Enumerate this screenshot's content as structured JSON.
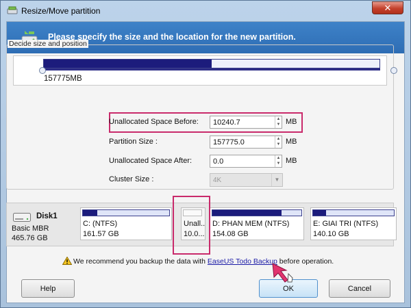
{
  "window": {
    "title": "Resize/Move partition",
    "close_label": "✕"
  },
  "banner": {
    "text": "Please specify the size and the location for the new partition."
  },
  "group": {
    "legend": "Decide size and position"
  },
  "slider": {
    "size_label": "157775MB",
    "fill_fraction": 0.5
  },
  "fields": {
    "before": {
      "label": "Unallocated Space Before:",
      "value": "10240.7",
      "unit": "MB"
    },
    "size": {
      "label": "Partition Size :",
      "value": "157775.0",
      "unit": "MB"
    },
    "after": {
      "label": "Unallocated Space After:",
      "value": "0.0",
      "unit": "MB"
    },
    "cluster": {
      "label": "Cluster Size :",
      "value": "4K"
    }
  },
  "disk": {
    "name": "Disk1",
    "type": "Basic MBR",
    "size": "465.76 GB",
    "partitions": [
      {
        "name": "C: (NTFS)",
        "size": "161.57 GB",
        "fill": 0.17
      },
      {
        "name": "Unall...",
        "size": "10.0...",
        "fill": 0
      },
      {
        "name": "D: PHAN MEM  (NTFS)",
        "size": "154.08 GB",
        "fill": 0.78
      },
      {
        "name": "E: GIAI TRI (NTFS)",
        "size": "140.10 GB",
        "fill": 0.16
      }
    ]
  },
  "notice": {
    "prefix": "We recommend you backup the data with ",
    "link": "EaseUS Todo Backup",
    "suffix": " before operation."
  },
  "buttons": {
    "help": "Help",
    "ok": "OK",
    "cancel": "Cancel"
  },
  "icons": {
    "app": "partition-tool-icon",
    "banner": "drive-resize-icon",
    "disk": "hard-disk-icon",
    "warning": "warning-icon",
    "cursor": "mouse-pointer-icon"
  },
  "colors": {
    "bar_fill": "#1c1c7c",
    "highlight": "#c92a6b",
    "banner": "#3e82c8"
  }
}
